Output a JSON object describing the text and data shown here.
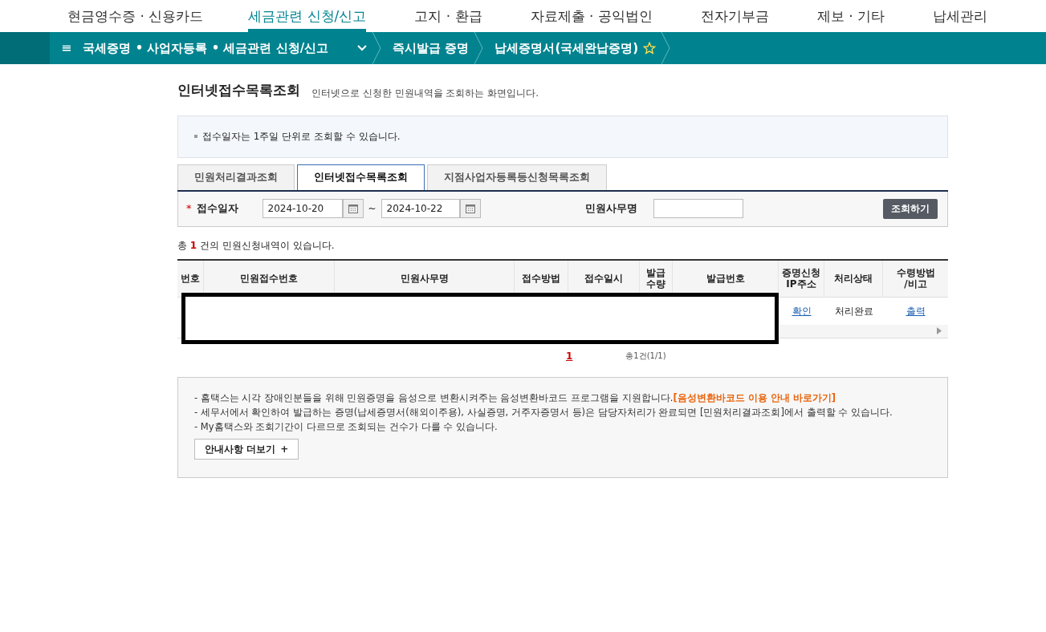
{
  "top_menu": [
    {
      "label": "현금영수증 · 신용카드",
      "selected": false
    },
    {
      "label": "세금관련 신청/신고",
      "selected": true
    },
    {
      "label": "고지 · 환급",
      "selected": false
    },
    {
      "label": "자료제출 · 공익법인",
      "selected": false
    },
    {
      "label": "전자기부금",
      "selected": false
    },
    {
      "label": "제보 · 기타",
      "selected": false
    },
    {
      "label": "납세관리",
      "selected": false
    }
  ],
  "breadcrumb": {
    "menu_icon": "≡",
    "items": [
      "국세증명 • 사업자등록 • 세금관련 신청/신고",
      "즉시발급 증명",
      "납세증명서(국세완납증명)"
    ]
  },
  "page": {
    "title": "인터넷접수목록조회",
    "subtitle": "인터넷으로 신청한 민원내역을 조회하는 화면입니다."
  },
  "notice": "접수일자는 1주일 단위로 조회할 수 있습니다.",
  "tabs": [
    {
      "label": "민원처리결과조회",
      "selected": false
    },
    {
      "label": "인터넷접수목록조회",
      "selected": true
    },
    {
      "label": "지점사업자등록등신청목록조회",
      "selected": false
    }
  ],
  "search": {
    "required_mark": "*",
    "date_label": "접수일자",
    "date_from": "2024-10-20",
    "date_separator": "~",
    "date_to": "2024-10-22",
    "name_label": "민원사무명",
    "button": "조회하기"
  },
  "summary": {
    "prefix": "총",
    "count": "1",
    "suffix": "건의 민원신청내역이 있습니다."
  },
  "table": {
    "columns": [
      "번호",
      "민원접수번호",
      "민원사무명",
      "접수방법",
      "접수일시",
      "발급\n수량",
      "발급번호",
      "증명신청\nIP주소",
      "처리상태",
      "수령방법\n/비고"
    ],
    "rows": [
      {
        "ip": "확인",
        "status": "처리완료",
        "receipt": "출력"
      }
    ]
  },
  "pagination": {
    "pages": [
      {
        "label": "1",
        "selected": true
      }
    ],
    "total": "총1건(1/1)"
  },
  "info": {
    "lines": [
      {
        "text": "- 홈택스는 시각 장애인분들을 위해 민원증명을 음성으로 변환시켜주는 음성변환바코드 프로그램을 지원합니다.",
        "link": "[음성변환바코드 이용 안내 바로가기]"
      },
      {
        "text": "- 세무서에서 확인하여 발급하는 증명(납세증명서(해외이주용), 사실증명, 거주자증명서 등)은 담당자처리가 완료되면 [민원처리결과조회]에서 출력할 수 있습니다."
      },
      {
        "text": "- My홈택스와 조회기간이 다르므로 조회되는 건수가 다를 수 있습니다."
      }
    ],
    "more_button": "안내사항 더보기",
    "more_icon": "+"
  }
}
